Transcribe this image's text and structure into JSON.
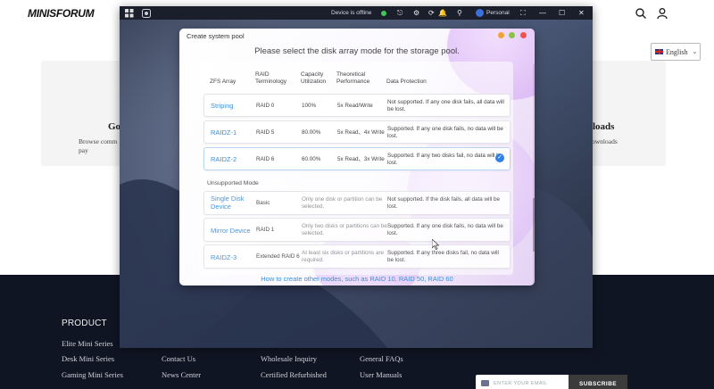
{
  "website": {
    "logo": "MINISFORUM",
    "language": "English",
    "hero_left_title": "Go",
    "hero_left_text": "Browse comm pay",
    "hero_right_title": "loads",
    "hero_right_text": "ownloads",
    "footer": {
      "heading": "PRODUCT",
      "columns": [
        [
          "Elite Mini Series",
          "Desk Mini Series",
          "Gaming Mini Series"
        ],
        [
          "Contact Us",
          "News Center"
        ],
        [
          "Wholesale Inquiry",
          "Certified Refurbished"
        ],
        [
          "General FAQs",
          "User Manuals"
        ]
      ],
      "newsletter_placeholder": "ENTER YOUR EMAIL",
      "newsletter_button": "SUBSCRIBE"
    }
  },
  "remote_window": {
    "status": "Device is offline",
    "user": "Personal",
    "status_color": "#3fc55a"
  },
  "dialog": {
    "title": "Create system pool",
    "heading": "Please select the disk array mode for the storage pool.",
    "columns": {
      "zfs": "ZFS Array",
      "raid": "RAID Terminology",
      "capacity": "Capacity Utilization",
      "performance": "Theoretical Performance",
      "protection": "Data Protection"
    },
    "supported_rows": [
      {
        "name": "Striping",
        "raid": "RAID 0",
        "capacity": "100%",
        "performance": "5x Read/Write",
        "protection": "Not supported. If any one disk fails, all data will be lost.",
        "selected": false
      },
      {
        "name": "RAIDZ-1",
        "raid": "RAID 5",
        "capacity": "80.00%",
        "performance": "5x Read、4x Write",
        "protection": "Supported. If any one disk fails, no data will be lost.",
        "selected": false
      },
      {
        "name": "RAIDZ-2",
        "raid": "RAID 6",
        "capacity": "60.00%",
        "performance": "5x Read、3x Write",
        "protection": "Supported. If any two disks fail, no data will be lost.",
        "selected": true
      }
    ],
    "unsupported_label": "Unsupported Mode",
    "unsupported_rows": [
      {
        "name": "Single Disk Device",
        "raid": "Basic",
        "reason": "Only one disk or partition can be selected.",
        "protection": "Not supported. If the disk fails, all data will be lost."
      },
      {
        "name": "Mirror Device",
        "raid": "RAID 1",
        "reason": "Only two disks or partitions can be selected.",
        "protection": "Supported. If any one disk fails, no data will be lost."
      },
      {
        "name": "RAIDZ-3",
        "raid": "Extended RAID 6",
        "reason": "At least six disks or partitions are required.",
        "protection": "Supported. If any three disks fail, no data will be lost."
      }
    ],
    "help_link": "How to create other modes, such as RAID 10, RAID 50, RAID 60",
    "accent": "#3b8fd9",
    "window_buttons": [
      "#f2a23a",
      "#8bc34a",
      "#ef5350"
    ]
  }
}
